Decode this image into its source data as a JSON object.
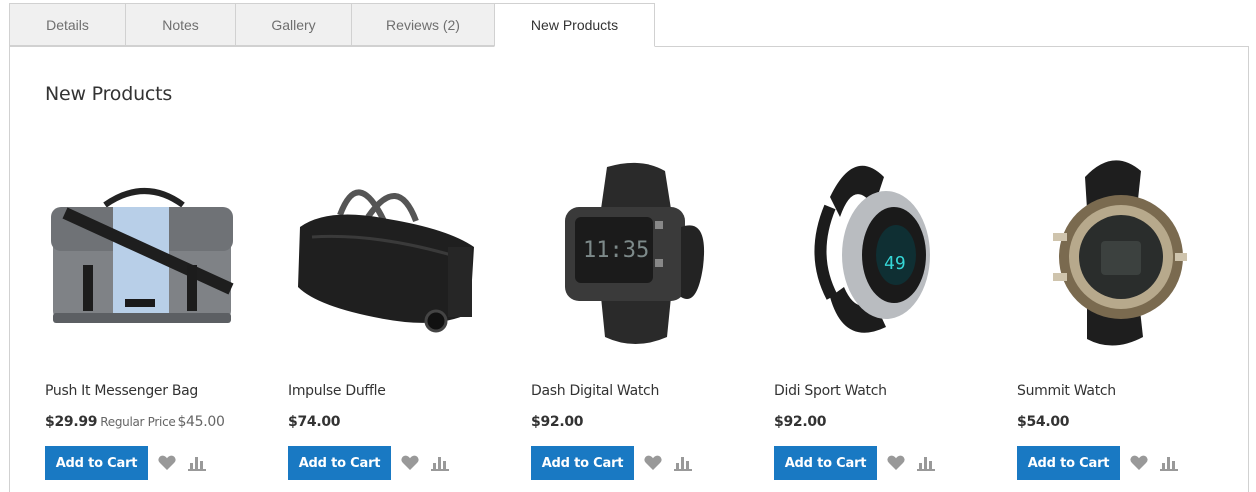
{
  "tabs": [
    {
      "label": "Details"
    },
    {
      "label": "Notes"
    },
    {
      "label": "Gallery"
    },
    {
      "label": "Reviews (2)"
    },
    {
      "label": "New Products"
    }
  ],
  "active_tab": "New Products",
  "section": {
    "title": "New Products"
  },
  "actions": {
    "add_to_cart_label": "Add to Cart",
    "wishlist_icon": "heart-icon",
    "compare_icon": "bar-chart-icon"
  },
  "colors": {
    "accent": "#1979c3",
    "icon": "#999999",
    "tab_inactive_bg": "#f0f0f0",
    "border": "#d1d1d1"
  },
  "products": [
    {
      "name": "Push It Messenger Bag",
      "price": "$29.99",
      "old_price_label": "Regular Price",
      "old_price": "$45.00"
    },
    {
      "name": "Impulse Duffle",
      "price": "$74.00"
    },
    {
      "name": "Dash Digital Watch",
      "price": "$92.00"
    },
    {
      "name": "Didi Sport Watch",
      "price": "$92.00"
    },
    {
      "name": "Summit Watch",
      "price": "$54.00"
    }
  ]
}
